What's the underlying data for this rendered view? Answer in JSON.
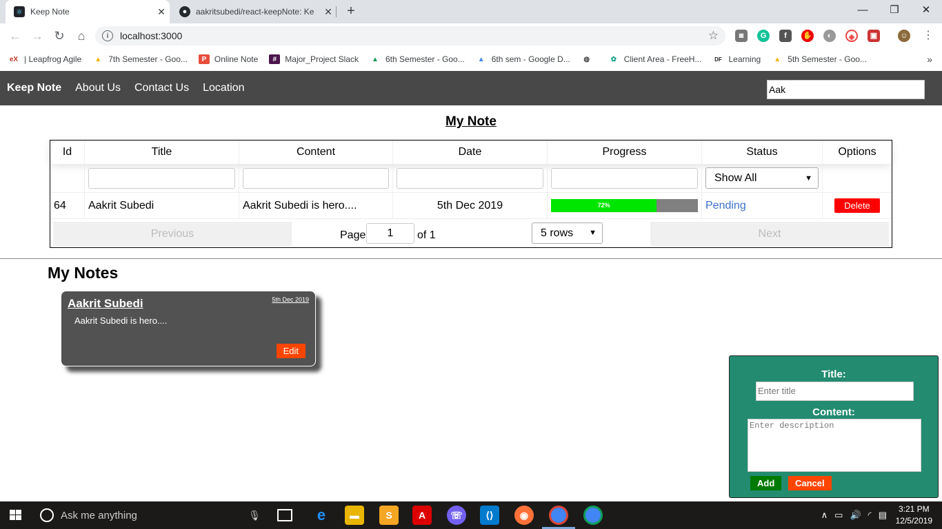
{
  "browser": {
    "tabs": [
      {
        "title": "Keep Note",
        "active": true
      },
      {
        "title": "aakritsubedi/react-keepNote: Ke",
        "active": false
      }
    ],
    "url": "localhost:3000",
    "bookmarks": [
      {
        "label": "| Leapfrog Agile",
        "icon": "edx-icon"
      },
      {
        "label": "7th Semester - Goo...",
        "icon": "google-drive-icon"
      },
      {
        "label": "Online Note",
        "icon": "online-note-icon"
      },
      {
        "label": "Major_Project Slack",
        "icon": "slack-icon"
      },
      {
        "label": "6th Semester - Goo...",
        "icon": "google-drive-icon"
      },
      {
        "label": "6th sem - Google D...",
        "icon": "google-drive-icon"
      },
      {
        "label": "",
        "icon": "globe-icon"
      },
      {
        "label": "Client Area - FreeH...",
        "icon": "freehost-icon"
      },
      {
        "label": "Learning",
        "icon": "learning-icon"
      },
      {
        "label": "5th Semester - Goo...",
        "icon": "google-drive-icon"
      }
    ]
  },
  "navbar": {
    "brand": "Keep Note",
    "links": [
      "About Us",
      "Contact Us",
      "Location"
    ],
    "search_value": "Aak"
  },
  "table": {
    "title": "My Note",
    "columns": [
      "Id",
      "Title",
      "Content",
      "Date",
      "Progress",
      "Status",
      "Options"
    ],
    "status_filter": "Show All",
    "rows": [
      {
        "id": "64",
        "title": "Aakrit Subedi",
        "content": "Aakrit Subedi is hero....",
        "date": "5th Dec 2019",
        "progress": 72,
        "progress_label": "72%",
        "status": "Pending",
        "option": "Delete"
      }
    ],
    "pagination": {
      "previous": "Previous",
      "page_label": "Page",
      "page": "1",
      "of_label": "of 1",
      "rows_select": "5 rows",
      "next": "Next"
    }
  },
  "notes_section": {
    "heading": "My Notes",
    "cards": [
      {
        "title": "Aakrit Subedi",
        "date": "5th Dec 2019",
        "content": "Aakrit Subedi is hero....",
        "edit": "Edit"
      }
    ]
  },
  "add_form": {
    "title_label": "Title:",
    "title_placeholder": "Enter title",
    "content_label": "Content:",
    "content_placeholder": "Enter description",
    "add": "Add",
    "cancel": "Cancel"
  },
  "taskbar": {
    "search_placeholder": "Ask me anything",
    "time": "3:21 PM",
    "date": "12/5/2019"
  },
  "colors": {
    "navbar_bg": "#484848",
    "progress_fill": "#00e600",
    "progress_track": "#808080",
    "delete": "#ff0000",
    "edit": "#ff4500",
    "add_panel": "#238b70",
    "add_btn": "#007a00",
    "status_link": "#3a6fc8"
  }
}
